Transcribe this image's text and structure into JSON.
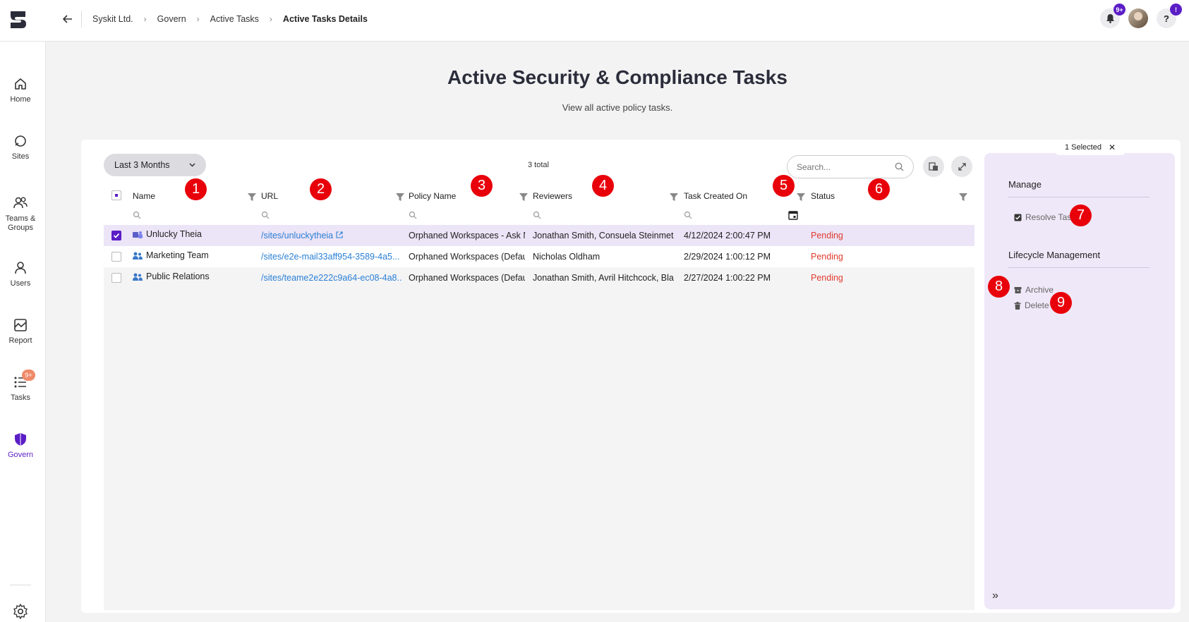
{
  "breadcrumb": [
    "Syskit Ltd.",
    "Govern",
    "Active Tasks",
    "Active Tasks Details"
  ],
  "breadcrumb_separator": "›",
  "header_badges": {
    "notifications": "9+",
    "help": "!"
  },
  "sidebar": {
    "items": [
      {
        "label": "Home",
        "icon": "home-icon"
      },
      {
        "label": "Sites",
        "icon": "sites-icon"
      },
      {
        "label": "Teams & Groups",
        "icon": "teams-icon"
      },
      {
        "label": "Users",
        "icon": "users-icon"
      },
      {
        "label": "Report",
        "icon": "report-icon"
      },
      {
        "label": "Tasks",
        "icon": "tasks-icon",
        "badge": "9+"
      },
      {
        "label": "Govern",
        "icon": "shield-icon",
        "active": true
      }
    ]
  },
  "page": {
    "title": "Active Security & Compliance Tasks",
    "subtitle": "View all active policy tasks."
  },
  "toolbar": {
    "period": "Last 3 Months",
    "total": "3 total",
    "search_placeholder": "Search..."
  },
  "table": {
    "columns": [
      "Name",
      "URL",
      "Policy Name",
      "Reviewers",
      "Task Created On",
      "Status"
    ],
    "rows": [
      {
        "name": "Unlucky Theia",
        "url": "/sites/unluckytheia",
        "policy": "Orphaned Workspaces - Ask M...",
        "reviewers": "Jonathan Smith, Consuela Steinmetz...",
        "created": "4/12/2024 2:00:47 PM",
        "status": "Pending",
        "selected": true,
        "icon": "teams-icon"
      },
      {
        "name": "Marketing Team",
        "url": "/sites/e2e-mail33aff954-3589-4a5...",
        "policy": "Orphaned Workspaces (Default ...",
        "reviewers": "Nicholas Oldham",
        "created": "2/29/2024 1:00:12 PM",
        "status": "Pending",
        "selected": false,
        "icon": "group-icon"
      },
      {
        "name": "Public Relations",
        "url": "/sites/teame2e222c9a64-ec08-4a8...",
        "policy": "Orphaned Workspaces (Default ...",
        "reviewers": "Jonathan Smith, Avril Hitchcock, Bla...",
        "created": "2/27/2024 1:00:22 PM",
        "status": "Pending",
        "selected": false,
        "icon": "group-icon"
      }
    ]
  },
  "panel": {
    "selected_label": "1 Selected",
    "close": "✕",
    "manage_heading": "Manage",
    "resolve_label": "Resolve Task",
    "lifecycle_heading": "Lifecycle Management",
    "archive_label": "Archive",
    "delete_label": "Delete",
    "collapse": "»"
  },
  "annotations": [
    "1",
    "2",
    "3",
    "4",
    "5",
    "6",
    "7",
    "8",
    "9"
  ],
  "colors": {
    "accent": "#5b1ec6",
    "link": "#2a7fd4",
    "status_pending": "#e03c2e",
    "annotation": "#e8000a",
    "panel_bg": "#efe8f8"
  }
}
